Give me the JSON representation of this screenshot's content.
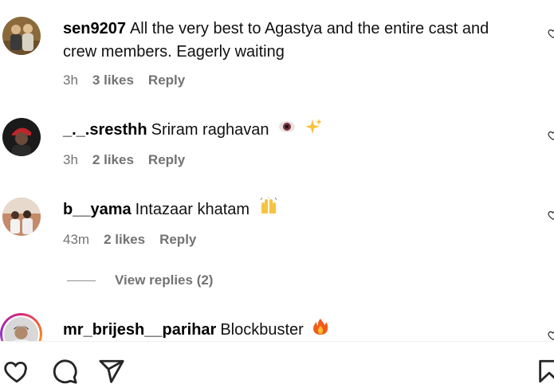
{
  "comments": [
    {
      "username": "sen9207",
      "text": "All the very best to Agastya and the entire cast and crew members. Eagerly waiting",
      "time": "3h",
      "likes": "3 likes",
      "reply": "Reply",
      "avatar": "avatar-two-people"
    },
    {
      "username": "_._.sresthh",
      "text": "Sriram raghavan",
      "emojis": [
        "eye-emoji",
        "sparkles-emoji"
      ],
      "time": "3h",
      "likes": "2 likes",
      "reply": "Reply",
      "avatar": "avatar-red-cap"
    },
    {
      "username": "b__yama",
      "text": "Intazaar khatam",
      "emojis": [
        "raising-hands-emoji"
      ],
      "time": "43m",
      "likes": "2 likes",
      "reply": "Reply",
      "avatar": "avatar-group"
    },
    {
      "username": "mr_brijesh__parihar",
      "text": "Blockbuster",
      "emojis": [
        "fire-emoji"
      ],
      "avatar": "avatar-story-ring"
    }
  ],
  "view_replies": "View replies (2)",
  "actions": [
    "like-icon",
    "comment-icon",
    "share-icon",
    "save-icon"
  ],
  "colors": {
    "secondary_text": "#737373",
    "story_ring": "#d62976"
  }
}
